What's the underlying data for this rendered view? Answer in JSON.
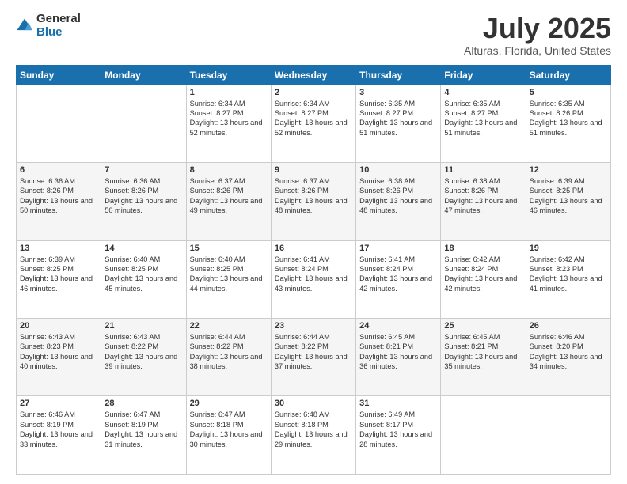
{
  "logo": {
    "general": "General",
    "blue": "Blue"
  },
  "title": "July 2025",
  "subtitle": "Alturas, Florida, United States",
  "days_of_week": [
    "Sunday",
    "Monday",
    "Tuesday",
    "Wednesday",
    "Thursday",
    "Friday",
    "Saturday"
  ],
  "weeks": [
    [
      {
        "day": "",
        "sunrise": "",
        "sunset": "",
        "daylight": ""
      },
      {
        "day": "",
        "sunrise": "",
        "sunset": "",
        "daylight": ""
      },
      {
        "day": "1",
        "sunrise": "Sunrise: 6:34 AM",
        "sunset": "Sunset: 8:27 PM",
        "daylight": "Daylight: 13 hours and 52 minutes."
      },
      {
        "day": "2",
        "sunrise": "Sunrise: 6:34 AM",
        "sunset": "Sunset: 8:27 PM",
        "daylight": "Daylight: 13 hours and 52 minutes."
      },
      {
        "day": "3",
        "sunrise": "Sunrise: 6:35 AM",
        "sunset": "Sunset: 8:27 PM",
        "daylight": "Daylight: 13 hours and 51 minutes."
      },
      {
        "day": "4",
        "sunrise": "Sunrise: 6:35 AM",
        "sunset": "Sunset: 8:27 PM",
        "daylight": "Daylight: 13 hours and 51 minutes."
      },
      {
        "day": "5",
        "sunrise": "Sunrise: 6:35 AM",
        "sunset": "Sunset: 8:26 PM",
        "daylight": "Daylight: 13 hours and 51 minutes."
      }
    ],
    [
      {
        "day": "6",
        "sunrise": "Sunrise: 6:36 AM",
        "sunset": "Sunset: 8:26 PM",
        "daylight": "Daylight: 13 hours and 50 minutes."
      },
      {
        "day": "7",
        "sunrise": "Sunrise: 6:36 AM",
        "sunset": "Sunset: 8:26 PM",
        "daylight": "Daylight: 13 hours and 50 minutes."
      },
      {
        "day": "8",
        "sunrise": "Sunrise: 6:37 AM",
        "sunset": "Sunset: 8:26 PM",
        "daylight": "Daylight: 13 hours and 49 minutes."
      },
      {
        "day": "9",
        "sunrise": "Sunrise: 6:37 AM",
        "sunset": "Sunset: 8:26 PM",
        "daylight": "Daylight: 13 hours and 48 minutes."
      },
      {
        "day": "10",
        "sunrise": "Sunrise: 6:38 AM",
        "sunset": "Sunset: 8:26 PM",
        "daylight": "Daylight: 13 hours and 48 minutes."
      },
      {
        "day": "11",
        "sunrise": "Sunrise: 6:38 AM",
        "sunset": "Sunset: 8:26 PM",
        "daylight": "Daylight: 13 hours and 47 minutes."
      },
      {
        "day": "12",
        "sunrise": "Sunrise: 6:39 AM",
        "sunset": "Sunset: 8:25 PM",
        "daylight": "Daylight: 13 hours and 46 minutes."
      }
    ],
    [
      {
        "day": "13",
        "sunrise": "Sunrise: 6:39 AM",
        "sunset": "Sunset: 8:25 PM",
        "daylight": "Daylight: 13 hours and 46 minutes."
      },
      {
        "day": "14",
        "sunrise": "Sunrise: 6:40 AM",
        "sunset": "Sunset: 8:25 PM",
        "daylight": "Daylight: 13 hours and 45 minutes."
      },
      {
        "day": "15",
        "sunrise": "Sunrise: 6:40 AM",
        "sunset": "Sunset: 8:25 PM",
        "daylight": "Daylight: 13 hours and 44 minutes."
      },
      {
        "day": "16",
        "sunrise": "Sunrise: 6:41 AM",
        "sunset": "Sunset: 8:24 PM",
        "daylight": "Daylight: 13 hours and 43 minutes."
      },
      {
        "day": "17",
        "sunrise": "Sunrise: 6:41 AM",
        "sunset": "Sunset: 8:24 PM",
        "daylight": "Daylight: 13 hours and 42 minutes."
      },
      {
        "day": "18",
        "sunrise": "Sunrise: 6:42 AM",
        "sunset": "Sunset: 8:24 PM",
        "daylight": "Daylight: 13 hours and 42 minutes."
      },
      {
        "day": "19",
        "sunrise": "Sunrise: 6:42 AM",
        "sunset": "Sunset: 8:23 PM",
        "daylight": "Daylight: 13 hours and 41 minutes."
      }
    ],
    [
      {
        "day": "20",
        "sunrise": "Sunrise: 6:43 AM",
        "sunset": "Sunset: 8:23 PM",
        "daylight": "Daylight: 13 hours and 40 minutes."
      },
      {
        "day": "21",
        "sunrise": "Sunrise: 6:43 AM",
        "sunset": "Sunset: 8:22 PM",
        "daylight": "Daylight: 13 hours and 39 minutes."
      },
      {
        "day": "22",
        "sunrise": "Sunrise: 6:44 AM",
        "sunset": "Sunset: 8:22 PM",
        "daylight": "Daylight: 13 hours and 38 minutes."
      },
      {
        "day": "23",
        "sunrise": "Sunrise: 6:44 AM",
        "sunset": "Sunset: 8:22 PM",
        "daylight": "Daylight: 13 hours and 37 minutes."
      },
      {
        "day": "24",
        "sunrise": "Sunrise: 6:45 AM",
        "sunset": "Sunset: 8:21 PM",
        "daylight": "Daylight: 13 hours and 36 minutes."
      },
      {
        "day": "25",
        "sunrise": "Sunrise: 6:45 AM",
        "sunset": "Sunset: 8:21 PM",
        "daylight": "Daylight: 13 hours and 35 minutes."
      },
      {
        "day": "26",
        "sunrise": "Sunrise: 6:46 AM",
        "sunset": "Sunset: 8:20 PM",
        "daylight": "Daylight: 13 hours and 34 minutes."
      }
    ],
    [
      {
        "day": "27",
        "sunrise": "Sunrise: 6:46 AM",
        "sunset": "Sunset: 8:19 PM",
        "daylight": "Daylight: 13 hours and 33 minutes."
      },
      {
        "day": "28",
        "sunrise": "Sunrise: 6:47 AM",
        "sunset": "Sunset: 8:19 PM",
        "daylight": "Daylight: 13 hours and 31 minutes."
      },
      {
        "day": "29",
        "sunrise": "Sunrise: 6:47 AM",
        "sunset": "Sunset: 8:18 PM",
        "daylight": "Daylight: 13 hours and 30 minutes."
      },
      {
        "day": "30",
        "sunrise": "Sunrise: 6:48 AM",
        "sunset": "Sunset: 8:18 PM",
        "daylight": "Daylight: 13 hours and 29 minutes."
      },
      {
        "day": "31",
        "sunrise": "Sunrise: 6:49 AM",
        "sunset": "Sunset: 8:17 PM",
        "daylight": "Daylight: 13 hours and 28 minutes."
      },
      {
        "day": "",
        "sunrise": "",
        "sunset": "",
        "daylight": ""
      },
      {
        "day": "",
        "sunrise": "",
        "sunset": "",
        "daylight": ""
      }
    ]
  ]
}
